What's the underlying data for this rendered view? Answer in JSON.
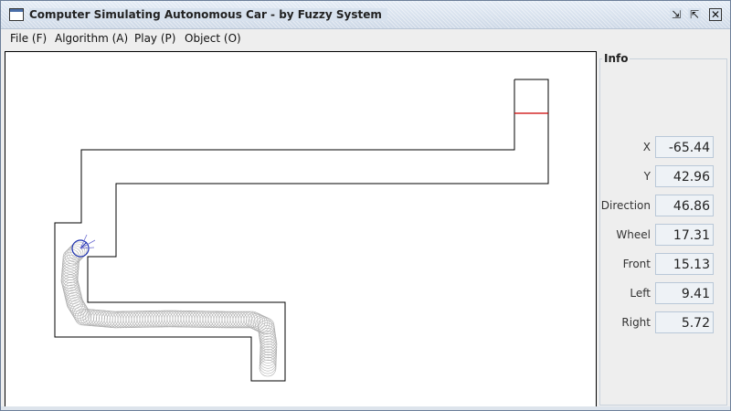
{
  "window": {
    "title": "Computer Simulating Autonomous Car - by Fuzzy System",
    "buttons": [
      "minimize-icon",
      "maximize-icon",
      "close-icon"
    ]
  },
  "menu": [
    {
      "label": "File (F)"
    },
    {
      "label": "Algorithm (A)"
    },
    {
      "label": "Play (P)"
    },
    {
      "label": "Object (O)"
    }
  ],
  "info": {
    "title": "Info",
    "rows": [
      {
        "label": "X",
        "value": "-65.44"
      },
      {
        "label": "Y",
        "value": "42.96"
      },
      {
        "label": "Direction",
        "value": "46.86"
      },
      {
        "label": "Wheel",
        "value": "17.31"
      },
      {
        "label": "Front",
        "value": "15.13"
      },
      {
        "label": "Left",
        "value": "9.41"
      },
      {
        "label": "Right",
        "value": "5.72"
      }
    ]
  },
  "colors": {
    "track": "#000000",
    "finish_line": "#cc0000",
    "trail": "#b0b0b0",
    "car": "#1a2fb0"
  }
}
